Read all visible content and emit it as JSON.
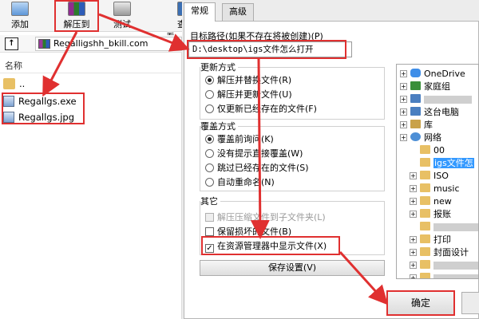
{
  "toolbar": {
    "add_label": "添加",
    "extract_label": "解压到",
    "test_label": "测试",
    "view_label": "查看"
  },
  "address": {
    "archive_name": "Regalligshh_bkill.com"
  },
  "file_list": {
    "column_name": "名称",
    "parent": "..",
    "files": [
      "Regallgs.exe",
      "Regallgs.jpg"
    ]
  },
  "dialog": {
    "tabs": [
      "常规",
      "高级"
    ],
    "dest_label": "目标路径(如果不存在将被创建)(P)",
    "dest_value": "D:\\desktop\\igs文件怎么打开",
    "update_group": {
      "title": "更新方式",
      "options": [
        "解压并替换文件(R)",
        "解压并更新文件(U)",
        "仅更新已经存在的文件(F)"
      ],
      "selected": 0
    },
    "overwrite_group": {
      "title": "覆盖方式",
      "options": [
        "覆盖前询问(K)",
        "没有提示直接覆盖(W)",
        "跳过已经存在的文件(S)",
        "自动重命名(N)"
      ],
      "selected": 0
    },
    "other_group": {
      "title": "其它",
      "options": [
        {
          "label": "解压压缩文件到子文件夹(L)",
          "checked": false,
          "disabled": true
        },
        {
          "label": "保留损坏的文件(B)",
          "checked": false,
          "disabled": false
        },
        {
          "label": "在资源管理器中显示文件(X)",
          "checked": true,
          "disabled": false
        }
      ]
    },
    "save_settings": "保存设置(V)",
    "ok": "确定",
    "tree": [
      {
        "label": "OneDrive",
        "icon": "cloud-icon",
        "expander": "+"
      },
      {
        "label": "家庭组",
        "icon": "homegroup-icon",
        "expander": "+"
      },
      {
        "label": "",
        "icon": "user-folder-icon",
        "expander": "+"
      },
      {
        "label": "这台电脑",
        "icon": "computer-icon",
        "expander": "+"
      },
      {
        "label": "库",
        "icon": "library-icon",
        "expander": "+"
      },
      {
        "label": "网络",
        "icon": "network-icon",
        "expander": "+"
      },
      {
        "label": "00",
        "icon": "folder-icon",
        "expander": ""
      },
      {
        "label": "igs文件怎",
        "icon": "folder-icon",
        "expander": "",
        "selected": true
      },
      {
        "label": "ISO",
        "icon": "folder-icon",
        "expander": "+"
      },
      {
        "label": "music",
        "icon": "folder-icon",
        "expander": "+"
      },
      {
        "label": "new",
        "icon": "folder-icon",
        "expander": "+"
      },
      {
        "label": "报账",
        "icon": "folder-icon",
        "expander": "+"
      },
      {
        "label": "",
        "icon": "folder-icon",
        "expander": ""
      },
      {
        "label": "打印",
        "icon": "folder-icon",
        "expander": "+"
      },
      {
        "label": "封面设计",
        "icon": "folder-icon",
        "expander": "+"
      },
      {
        "label": "",
        "icon": "folder-icon",
        "expander": "+"
      },
      {
        "label": "",
        "icon": "folder-icon",
        "expander": "+"
      }
    ]
  },
  "colors": {
    "highlight": "#e03030",
    "selection": "#3399ff"
  }
}
